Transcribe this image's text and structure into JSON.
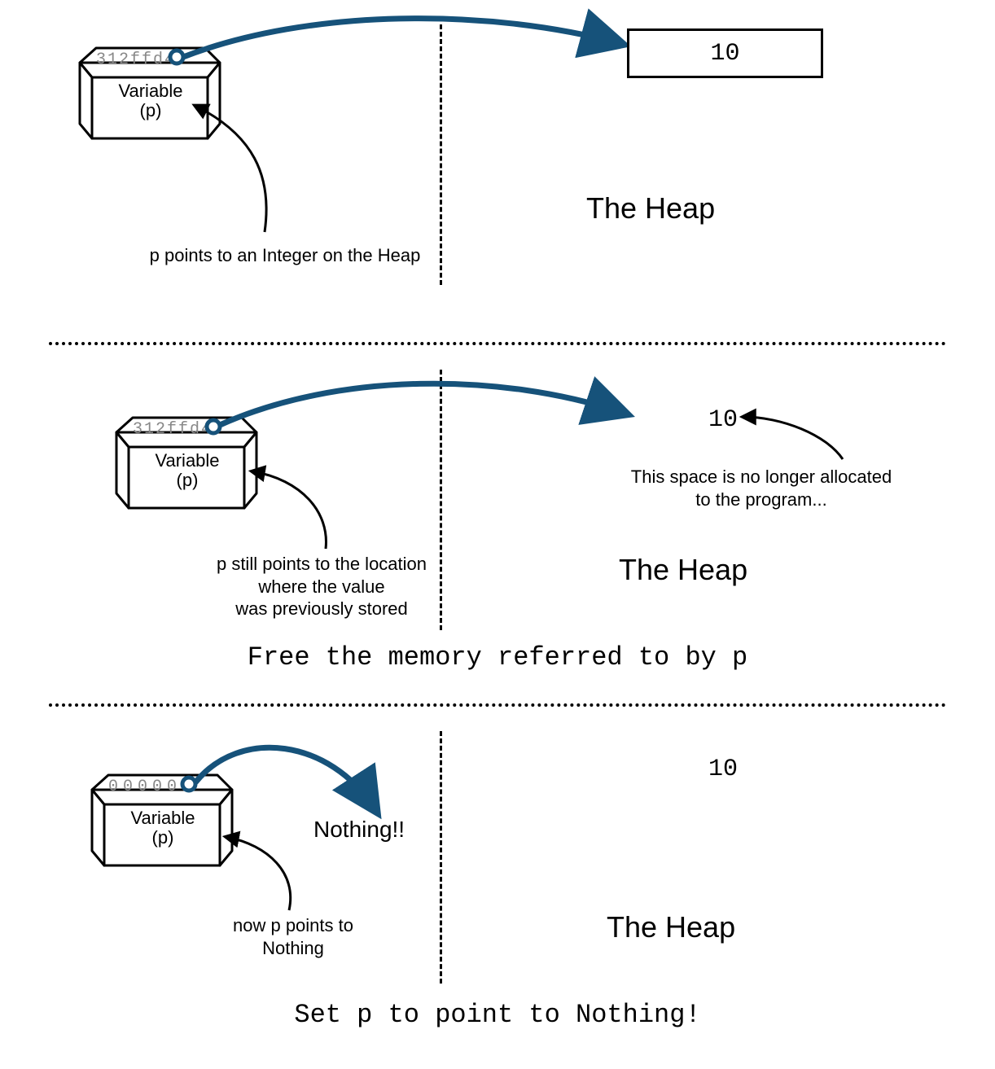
{
  "arrow_color": "#16527a",
  "panel1": {
    "box_addr": "312ffd4",
    "box_label_line1": "Variable",
    "box_label_line2": "(p)",
    "heap_value": "10",
    "heap_title": "The Heap",
    "caption_bottom": "p points to an Integer on the Heap"
  },
  "panel2": {
    "box_addr": "312ffd4",
    "box_label_line1": "Variable",
    "box_label_line2": "(p)",
    "heap_value": "10",
    "heap_title": "The Heap",
    "heap_note_line1": "This space is no longer allocated",
    "heap_note_line2": "to the program...",
    "box_note_line1": "p still points to the location",
    "box_note_line2": "where the value",
    "box_note_line3": "was previously stored",
    "caption_mono": "Free the memory referred to by p"
  },
  "panel3": {
    "box_addr": "00000",
    "box_label_line1": "Variable",
    "box_label_line2": "(p)",
    "heap_value": "10",
    "heap_title": "The Heap",
    "nothing_label": "Nothing!!",
    "box_note_line1": "now p points to",
    "box_note_line2": "Nothing",
    "caption_mono": "Set p to point to Nothing!"
  }
}
